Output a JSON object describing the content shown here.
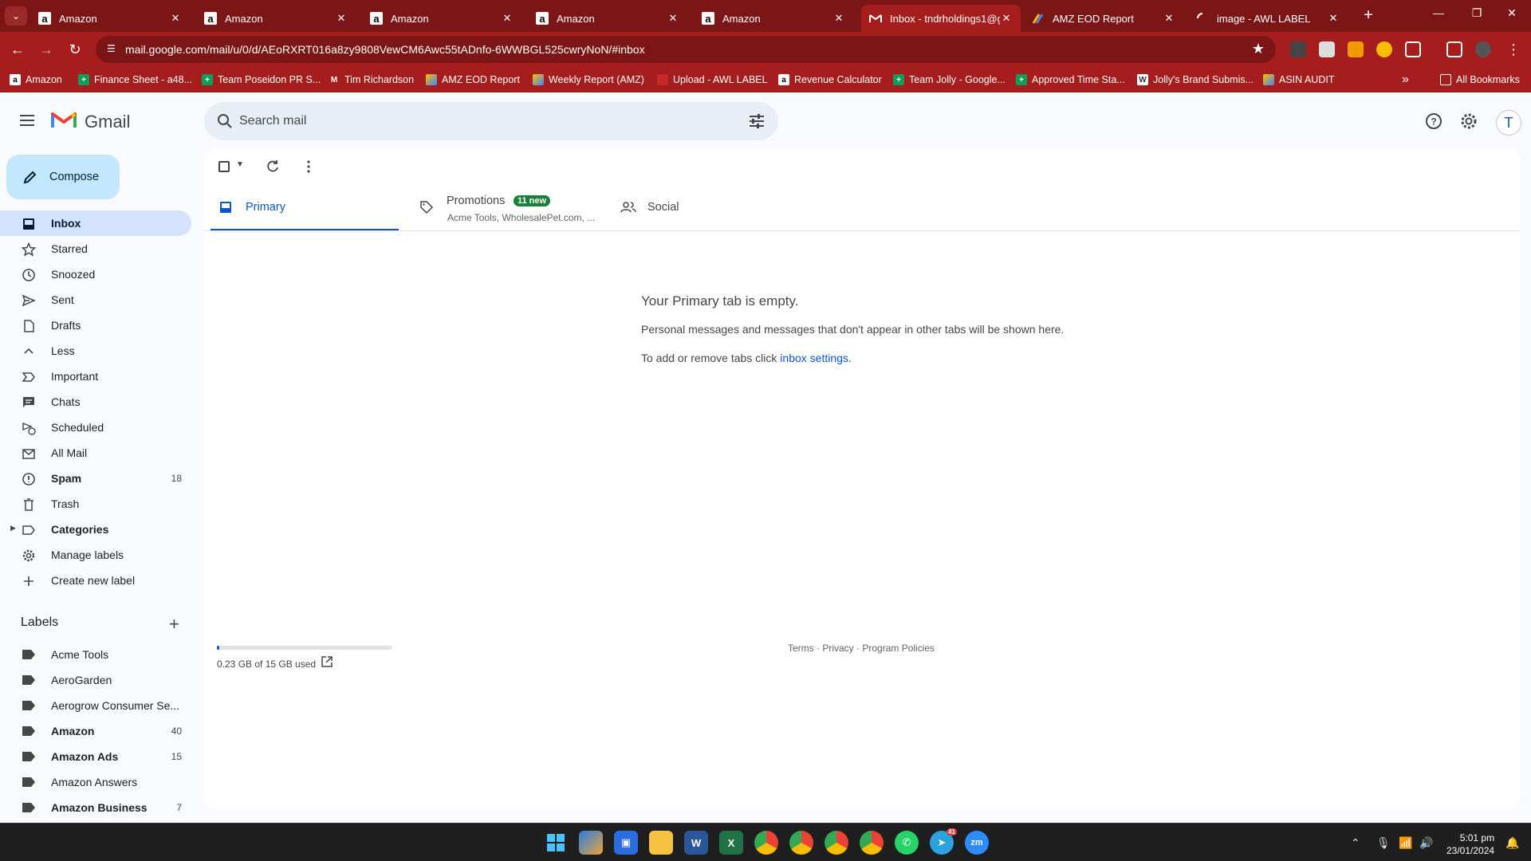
{
  "browser": {
    "tabs": [
      {
        "title": "Amazon",
        "icon": "amazon-icon"
      },
      {
        "title": "Amazon",
        "icon": "amazon-icon"
      },
      {
        "title": "Amazon",
        "icon": "amazon-icon"
      },
      {
        "title": "Amazon",
        "icon": "amazon-icon"
      },
      {
        "title": "Amazon",
        "icon": "amazon-icon"
      },
      {
        "title": "Inbox - tndrholdings1@g",
        "icon": "gmail-icon"
      },
      {
        "title": "AMZ EOD Report",
        "icon": "apps-script-icon"
      },
      {
        "title": "image - AWL LABEL",
        "icon": "loading-icon"
      }
    ],
    "url": "mail.google.com/mail/u/0/d/AEoRXRT016a8zy9808VewCM6Awc55tADnfo-6WWBGL525cwryNoN/#inbox",
    "bookmarks": [
      {
        "label": "Amazon",
        "icon": "amazon-icon"
      },
      {
        "label": "Finance Sheet - a48...",
        "icon": "sheets-icon"
      },
      {
        "label": "Team Poseidon PR S...",
        "icon": "sheets-icon"
      },
      {
        "label": "Tim Richardson",
        "icon": "gmail-icon"
      },
      {
        "label": "AMZ EOD Report",
        "icon": "apps-script-icon"
      },
      {
        "label": "Weekly Report (AMZ)",
        "icon": "apps-script-icon"
      },
      {
        "label": "Upload - AWL LABEL",
        "icon": "flag-icon"
      },
      {
        "label": "Revenue Calculator",
        "icon": "amazon-icon"
      },
      {
        "label": "Team Jolly - Google...",
        "icon": "sheets-icon"
      },
      {
        "label": "Approved Time Sta...",
        "icon": "sheets-icon"
      },
      {
        "label": "Jolly's Brand Submis...",
        "icon": "doc-icon"
      },
      {
        "label": "ASIN AUDIT",
        "icon": "apps-script-icon"
      }
    ],
    "all_bookmarks": "All Bookmarks",
    "overflow": "»"
  },
  "gmail": {
    "brand": "Gmail",
    "search_placeholder": "Search mail",
    "avatar_initial": "T",
    "compose": "Compose",
    "nav": [
      {
        "label": "Inbox",
        "icon": "inbox-icon",
        "count": ""
      },
      {
        "label": "Starred",
        "icon": "star-icon",
        "count": ""
      },
      {
        "label": "Snoozed",
        "icon": "clock-icon",
        "count": ""
      },
      {
        "label": "Sent",
        "icon": "send-icon",
        "count": ""
      },
      {
        "label": "Drafts",
        "icon": "draft-icon",
        "count": ""
      },
      {
        "label": "Less",
        "icon": "chevron-up-icon",
        "count": ""
      },
      {
        "label": "Important",
        "icon": "important-icon",
        "count": ""
      },
      {
        "label": "Chats",
        "icon": "chat-icon",
        "count": ""
      },
      {
        "label": "Scheduled",
        "icon": "scheduled-icon",
        "count": ""
      },
      {
        "label": "All Mail",
        "icon": "all-mail-icon",
        "count": ""
      },
      {
        "label": "Spam",
        "icon": "spam-icon",
        "count": "18"
      },
      {
        "label": "Trash",
        "icon": "trash-icon",
        "count": ""
      },
      {
        "label": "Categories",
        "icon": "label-icon",
        "count": ""
      },
      {
        "label": "Manage labels",
        "icon": "gear-icon",
        "count": ""
      },
      {
        "label": "Create new label",
        "icon": "plus-icon",
        "count": ""
      }
    ],
    "labels_header": "Labels",
    "labels": [
      {
        "label": "Acme Tools",
        "count": ""
      },
      {
        "label": "AeroGarden",
        "count": ""
      },
      {
        "label": "Aerogrow Consumer Se...",
        "count": ""
      },
      {
        "label": "Amazon",
        "count": "40"
      },
      {
        "label": "Amazon Ads",
        "count": "15"
      },
      {
        "label": "Amazon Answers",
        "count": ""
      },
      {
        "label": "Amazon Business",
        "count": "7"
      }
    ],
    "tabs": {
      "primary": "Primary",
      "promotions": "Promotions",
      "promotions_badge": "11 new",
      "promotions_senders": "Acme Tools, WholesalePet.com, ...",
      "social": "Social"
    },
    "empty": {
      "title": "Your Primary tab is empty.",
      "line1": "Personal messages and messages that don't appear in other tabs will be shown here.",
      "line2_prefix": "To add or remove tabs click ",
      "line2_link": "inbox settings",
      "line2_suffix": "."
    },
    "storage": {
      "text": "0.23 GB of 15 GB used",
      "fraction": 0.015
    },
    "footer": {
      "terms": "Terms",
      "privacy": "Privacy",
      "policies": "Program Policies",
      "sep": " · "
    }
  },
  "taskbar": {
    "clock_time": "5:01 pm",
    "clock_date": "23/01/2024",
    "zoom_label": "zm",
    "telegram_badge": "41"
  }
}
